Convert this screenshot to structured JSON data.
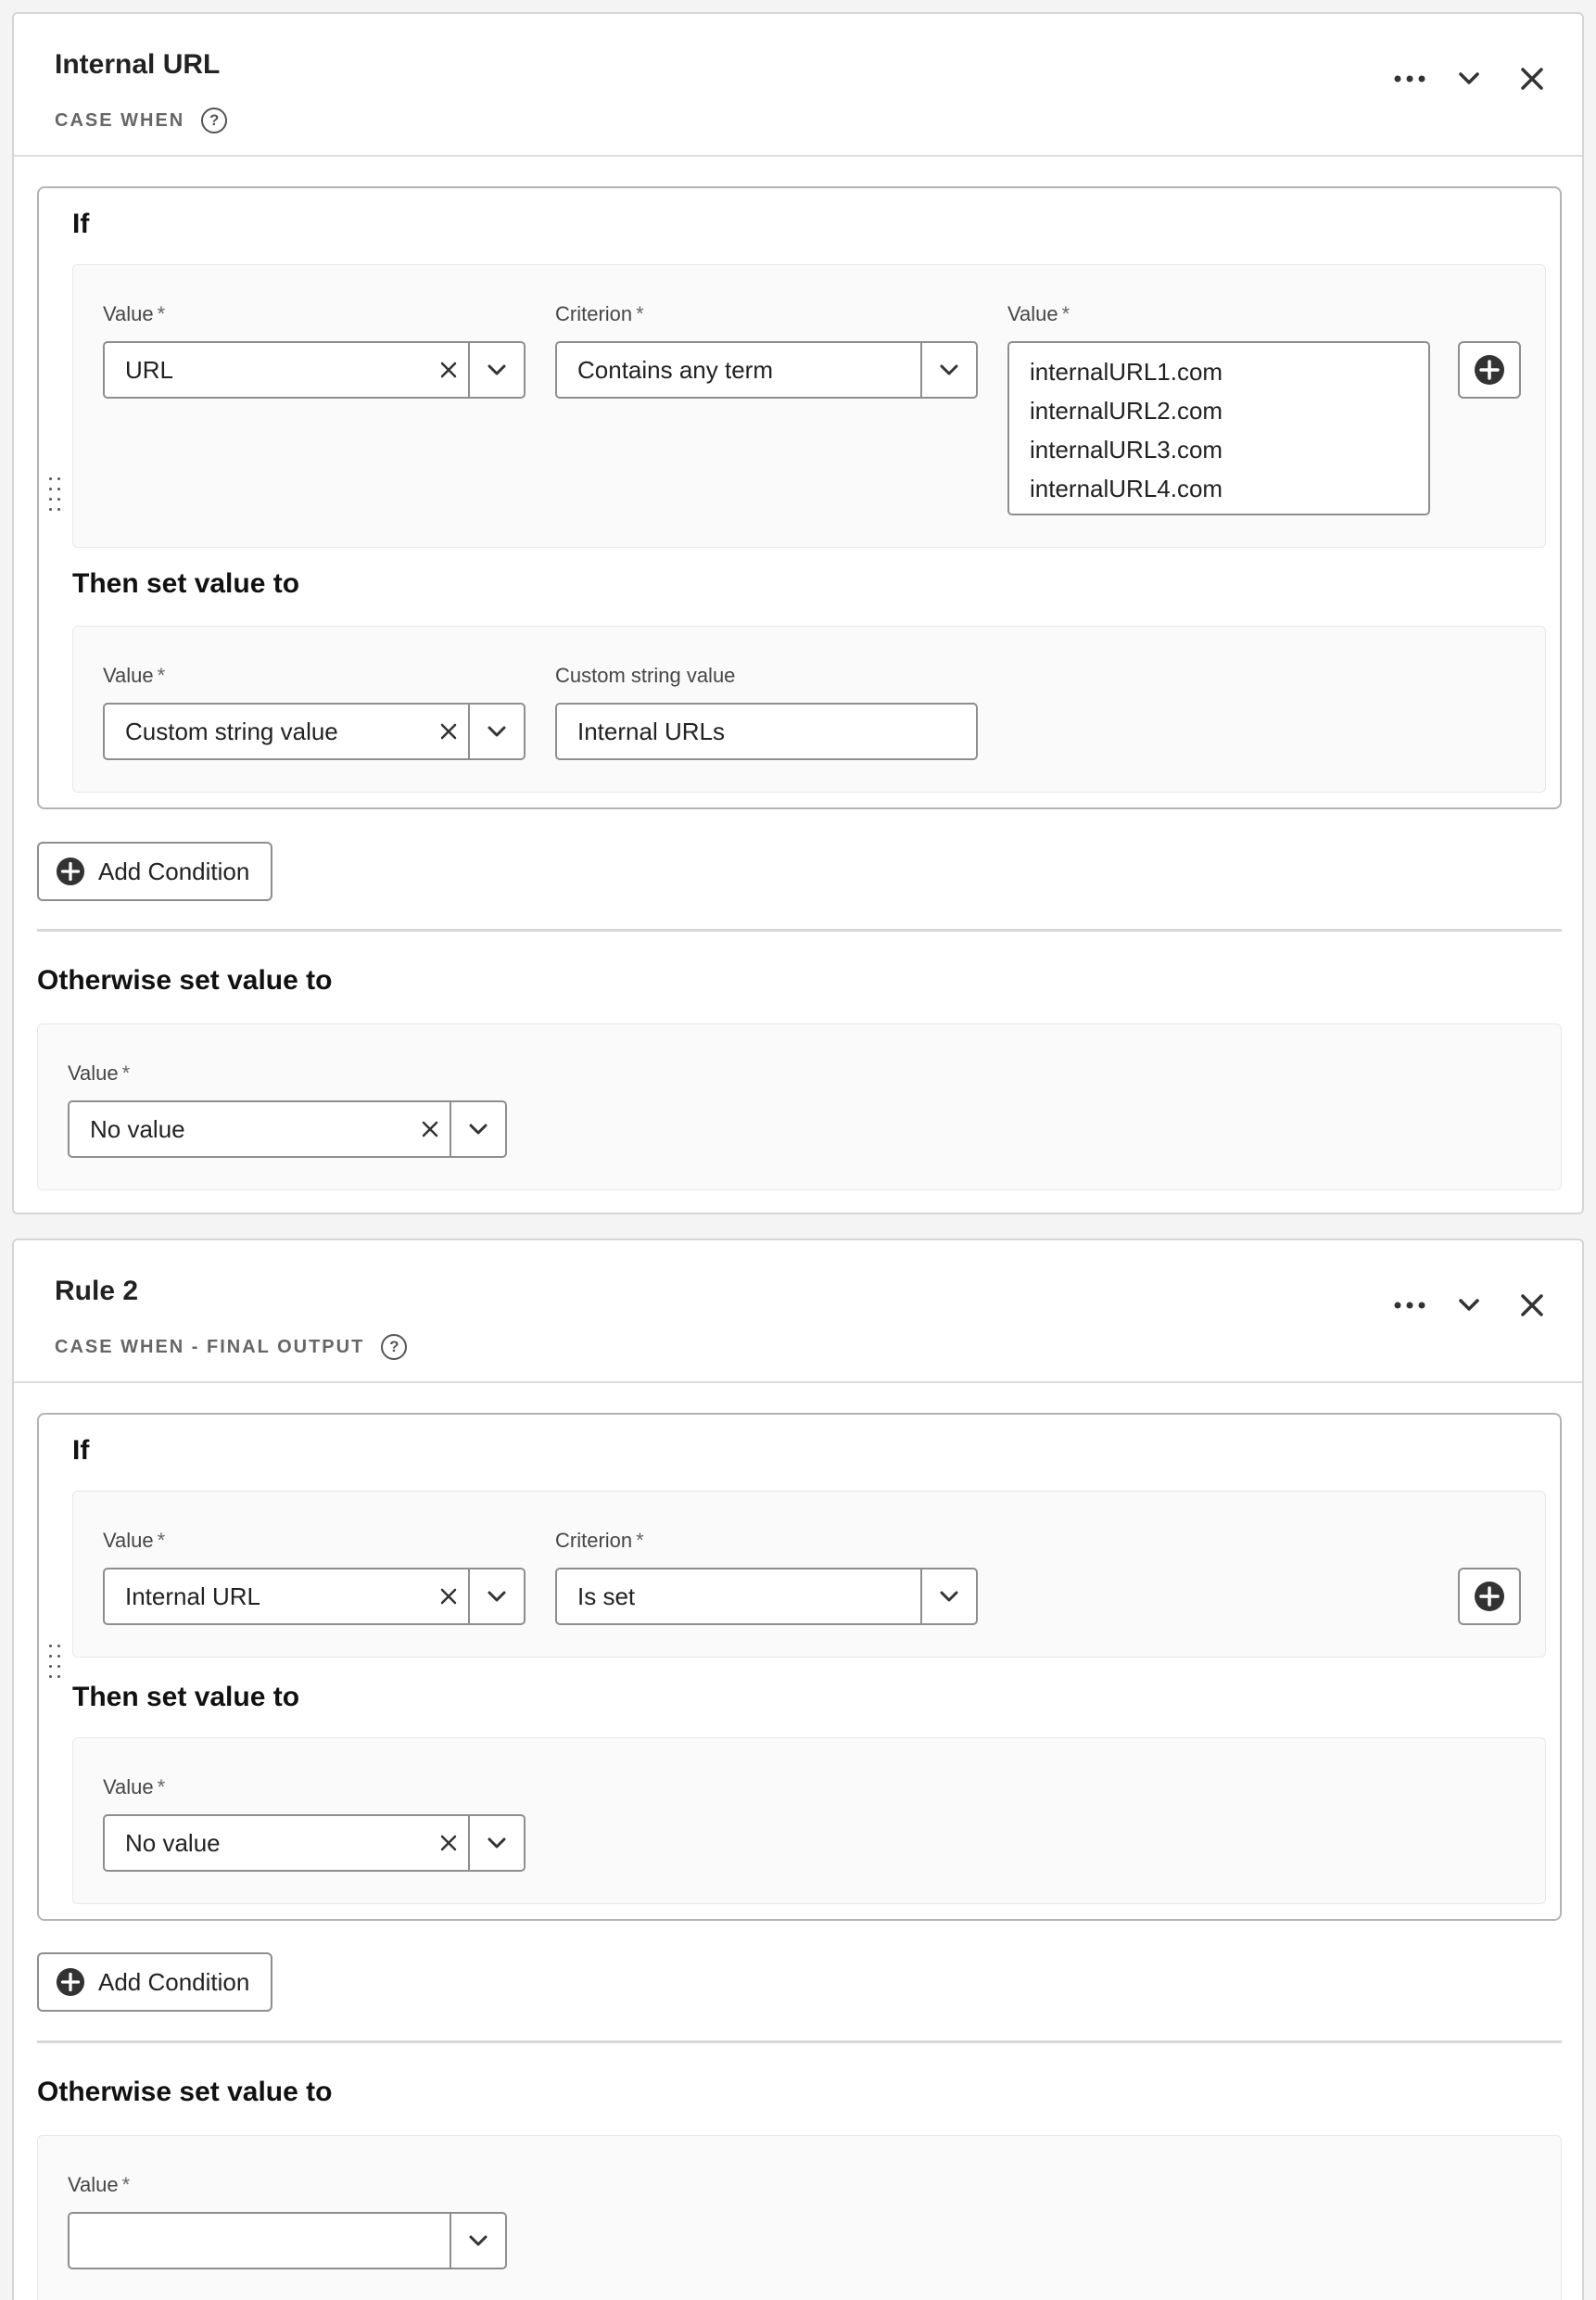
{
  "rules": [
    {
      "title": "Internal URL",
      "subtitle": "CASE WHEN",
      "if_label": "If",
      "condition": {
        "value_label": "Value",
        "value": "URL",
        "criterion_label": "Criterion",
        "criterion": "Contains any term",
        "terms_label": "Value",
        "terms": [
          "internalURL1.com",
          "internalURL2.com",
          "internalURL3.com",
          "internalURL4.com"
        ]
      },
      "then_label": "Then set value to",
      "then": {
        "value_label": "Value",
        "value": "Custom string value",
        "custom_label": "Custom string value",
        "custom_value": "Internal URLs"
      },
      "add_condition_label": "Add Condition",
      "otherwise_label": "Otherwise set value to",
      "otherwise": {
        "value_label": "Value",
        "value": "No value"
      }
    },
    {
      "title": "Rule 2",
      "subtitle": "CASE WHEN - FINAL OUTPUT",
      "if_label": "If",
      "condition": {
        "value_label": "Value",
        "value": "Internal URL",
        "criterion_label": "Criterion",
        "criterion": "Is set"
      },
      "then_label": "Then set value to",
      "then": {
        "value_label": "Value",
        "value": "No value"
      },
      "add_condition_label": "Add Condition",
      "otherwise_label": "Otherwise set value to",
      "otherwise": {
        "value_label": "Value",
        "value": ""
      }
    }
  ],
  "common": {
    "required_mark": "*",
    "help_glyph": "?"
  },
  "icons": [
    "more-icon",
    "chevron-down-icon",
    "close-icon",
    "clear-icon",
    "add-circle-icon",
    "drag-handle-icon",
    "help-icon"
  ]
}
